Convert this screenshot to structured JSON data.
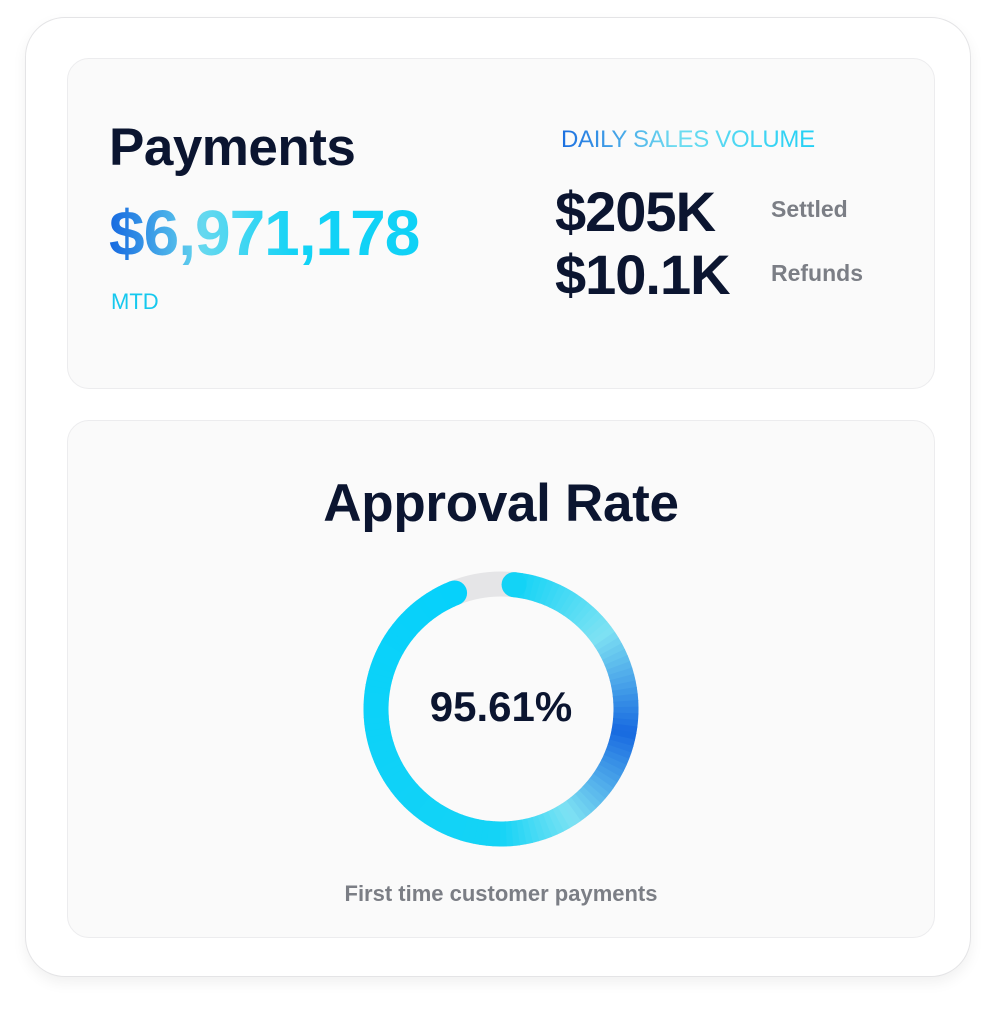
{
  "payments": {
    "title": "Payments",
    "total": "$6,971,178",
    "period": "MTD",
    "daily_sales_label": "DAILY SALES VOLUME",
    "metrics": [
      {
        "value": "$205K",
        "caption": "Settled"
      },
      {
        "value": "$10.1K",
        "caption": "Refunds"
      }
    ]
  },
  "approval": {
    "title": "Approval Rate",
    "value_label": "95.61%",
    "progress_fraction": 0.9561,
    "caption": "First time customer payments"
  },
  "colors": {
    "text_dark": "#0b1530",
    "text_muted": "#7b7e85",
    "accent_cyan": "#13d3f6",
    "accent_blue": "#1769e0",
    "track_gray": "#e5e5e7"
  }
}
